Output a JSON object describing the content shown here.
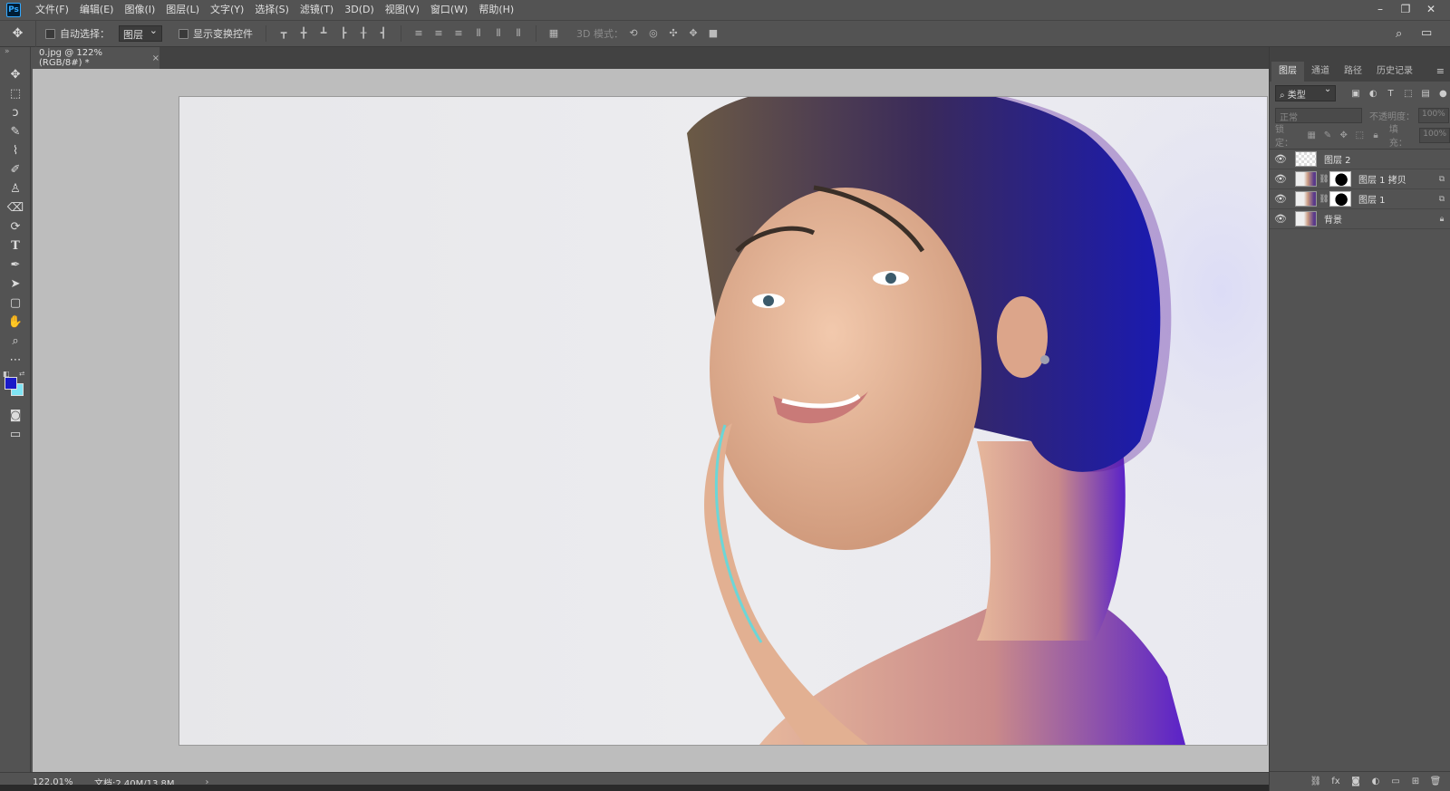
{
  "app": {
    "logo_text": "Ps",
    "menu": [
      "文件(F)",
      "编辑(E)",
      "图像(I)",
      "图层(L)",
      "文字(Y)",
      "选择(S)",
      "滤镜(T)",
      "3D(D)",
      "视图(V)",
      "窗口(W)",
      "帮助(H)"
    ]
  },
  "options": {
    "auto_select_label": "自动选择：",
    "auto_select_value": "图层",
    "show_transform_label": "显示变换控件",
    "mode3d_label": "3D 模式："
  },
  "document": {
    "tab_title": "0.jpg @ 122%(RGB/8#) *",
    "close_glyph": "×"
  },
  "colors": {
    "foreground": "#1a1ac8",
    "background": "#7fe4f4",
    "accent": "#31a8ff"
  },
  "status": {
    "zoom": "122.01%",
    "doc_info": "文档:2.40M/13.8M",
    "arrow": "›"
  },
  "layers_panel": {
    "tabs": [
      "图层",
      "通道",
      "路径",
      "历史记录"
    ],
    "filter_value": "类型",
    "blend_mode": "正常",
    "opacity_label": "不透明度：",
    "opacity_value": "100%",
    "lock_label": "锁定：",
    "fill_label": "填充：",
    "fill_value": "100%",
    "layers": [
      {
        "name": "图层 2",
        "thumb": "checker",
        "has_mask": false,
        "badge": ""
      },
      {
        "name": "图层 1 拷贝",
        "thumb": "photo",
        "has_mask": true,
        "badge": "fx-link"
      },
      {
        "name": "图层 1",
        "thumb": "photo",
        "has_mask": true,
        "badge": "fx-link"
      },
      {
        "name": "背景",
        "thumb": "photo",
        "has_mask": false,
        "badge": "lock"
      }
    ]
  }
}
